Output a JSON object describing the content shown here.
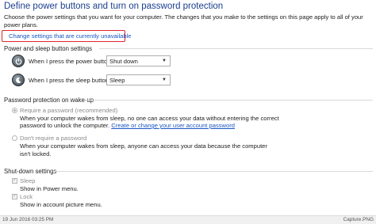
{
  "header": {
    "title": "Define power buttons and turn on password protection",
    "intro": "Choose the power settings that you want for your computer. The changes that you make to the settings on this page apply to all of your power plans.",
    "change_link": "Change settings that are currently unavailable"
  },
  "power_sleep": {
    "heading": "Power and sleep button settings",
    "power_label": "When I press the power button:",
    "power_value": "Shut down",
    "sleep_label": "When I press the sleep button:",
    "sleep_value": "Sleep"
  },
  "password": {
    "heading": "Password protection on wake-up",
    "require_label": "Require a password (recommended)",
    "require_desc_1": "When your computer wakes from sleep, no one can access your data without entering the correct",
    "require_desc_2": "password to unlock the computer.",
    "require_desc_link": "Create or change your user account password",
    "norequire_label": "Don't require a password",
    "norequire_desc": "When your computer wakes from sleep, anyone can access your data because the computer isn't locked."
  },
  "shutdown": {
    "heading": "Shut-down settings",
    "sleep_label": "Sleep",
    "sleep_desc": "Show in Power menu.",
    "lock_label": "Lock",
    "lock_desc": "Show in account picture menu."
  },
  "status": {
    "left": "19 Jun 2016 03:25 PM",
    "right": "Capture.PNG"
  },
  "colors": {
    "title": "#1a3f8f",
    "link": "#1a56c4",
    "highlight_border": "#e0242c"
  }
}
